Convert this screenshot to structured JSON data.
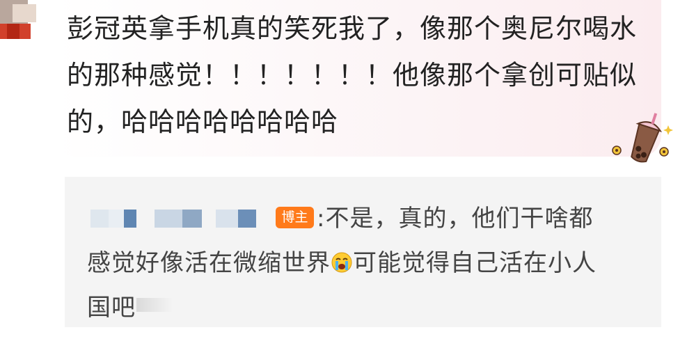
{
  "comment": {
    "text": "彭冠英拿手机真的笑死我了，像那个奥尼尔喝水的那种感觉！！！！！！！他像那个拿创可贴似的，哈哈哈哈哈哈哈哈"
  },
  "reply": {
    "badge": "博主",
    "colon_text": ":不是，真的，他们干啥都",
    "line2_before_emoji": "感觉好像活在微缩世界",
    "emoji": "crying-face",
    "line2_after_emoji": "可能觉得自己活在小人",
    "line3": "国吧"
  },
  "colors": {
    "badge": "#ff7a1a",
    "reply_background": "#f4f4f4"
  }
}
